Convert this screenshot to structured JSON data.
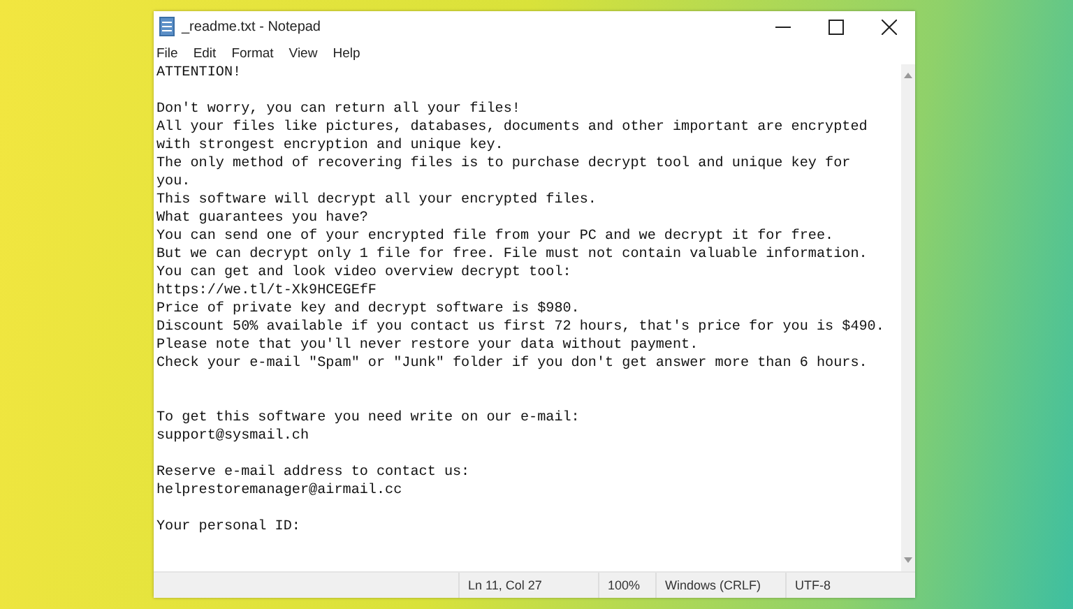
{
  "window": {
    "title": "_readme.txt - Notepad"
  },
  "menu": [
    "File",
    "Edit",
    "Format",
    "View",
    "Help"
  ],
  "blocks": [
    {
      "kind": "gap",
      "lines": [
        "ATTENTION!"
      ]
    },
    {
      "kind": "gap",
      "lines": [
        "Don't worry, you can return all your files!",
        "All your files like pictures, databases, documents and other important are encrypted",
        "with strongest encryption and unique key.",
        "The only method of recovering files is to purchase decrypt tool and unique key for",
        "you.",
        "This software will decrypt all your encrypted files.",
        "What guarantees you have?",
        "You can send one of your encrypted file from your PC and we decrypt it for free.",
        "But we can decrypt only 1 file for free. File must not contain valuable information.",
        "You can get and look video overview decrypt tool:",
        "https://we.tl/t-Xk9HCEGEfF",
        "Price of private key and decrypt software is $980.",
        "Discount 50% available if you contact us first 72 hours, that's price for you is $490.",
        "Please note that you'll never restore your data without payment.",
        "Check your e-mail \"Spam\" or \"Junk\" folder if you don't get answer more than 6 hours."
      ]
    },
    {
      "kind": "wide-gap",
      "lines": [
        "To get this software you need write on our e-mail:",
        "support@sysmail.ch"
      ]
    },
    {
      "kind": "gap",
      "lines": [
        "Reserve e-mail address to contact us:",
        "helprestoremanager@airmail.cc"
      ]
    },
    {
      "kind": "gap",
      "lines": [
        "Your personal ID:"
      ]
    }
  ],
  "status_bar": [
    "Ln 11, Col 27",
    "100%",
    "Windows (CRLF)",
    "UTF-8"
  ]
}
